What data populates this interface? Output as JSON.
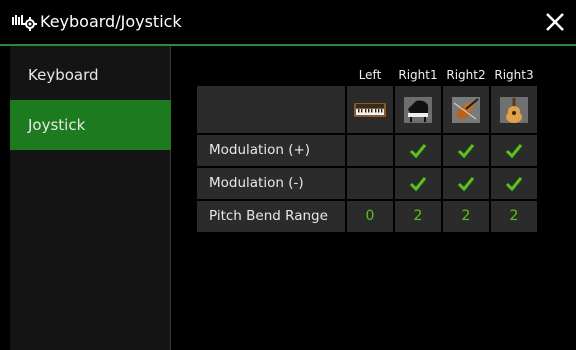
{
  "header": {
    "title": "Keyboard/Joystick",
    "icon": "keyboard-settings-icon"
  },
  "sidebar": {
    "items": [
      {
        "label": "Keyboard",
        "selected": false
      },
      {
        "label": "Joystick",
        "selected": true
      }
    ]
  },
  "table": {
    "columns": [
      "Left",
      "Right1",
      "Right2",
      "Right3"
    ],
    "voice_icons": [
      "synth-keyboard-icon",
      "grand-piano-icon",
      "violin-icon",
      "acoustic-guitar-icon"
    ],
    "rows": [
      {
        "label": "Modulation (+)",
        "cells": [
          "",
          "check",
          "check",
          "check"
        ]
      },
      {
        "label": "Modulation (-)",
        "cells": [
          "",
          "check",
          "check",
          "check"
        ]
      },
      {
        "label": "Pitch Bend Range",
        "cells": [
          "0",
          "2",
          "2",
          "2"
        ]
      }
    ]
  },
  "colors": {
    "accent": "#1e7a1e",
    "value": "#5ac21d",
    "cell": "#2b2b2b"
  }
}
